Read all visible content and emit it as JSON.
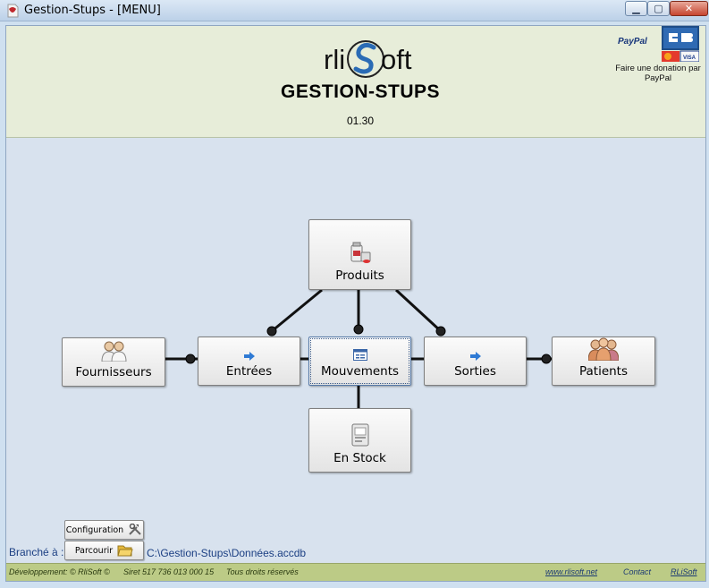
{
  "window": {
    "title": "Gestion-Stups - [MENU]",
    "minimize_icon": "minimize-icon",
    "maximize_icon": "maximize-icon",
    "close_icon": "close-icon"
  },
  "header": {
    "logo_text_left": "rli",
    "logo_text_right": "oft",
    "app_title": "GESTION-STUPS",
    "version": "01.30",
    "paypal_label": "PayPal",
    "donate_text": "Faire une donation par PayPal"
  },
  "nodes": {
    "produits": "Produits",
    "fournisseurs": "Fournisseurs",
    "entrees": "Entrées",
    "mouvements": "Mouvements",
    "sorties": "Sorties",
    "patients": "Patients",
    "en_stock": "En Stock"
  },
  "bottom": {
    "config_label": "Configuration",
    "browse_label": "Parcourir",
    "branche_label": "Branché à :",
    "db_path": "C:\\Gestion-Stups\\Données.accdb"
  },
  "footer": {
    "dev": "Développement: © RliSoft ©",
    "siret": "Siret 517 736 013 000 15",
    "rights": "Tous droits réservés",
    "site": "www.rlisoft.net",
    "contact": "Contact",
    "brand": "RLiSoft"
  },
  "colors": {
    "header_bg": "#e7edd9",
    "client_bg": "#d8e2ee",
    "footer_bg": "#bccb86",
    "link_blue": "#1b3f83"
  }
}
